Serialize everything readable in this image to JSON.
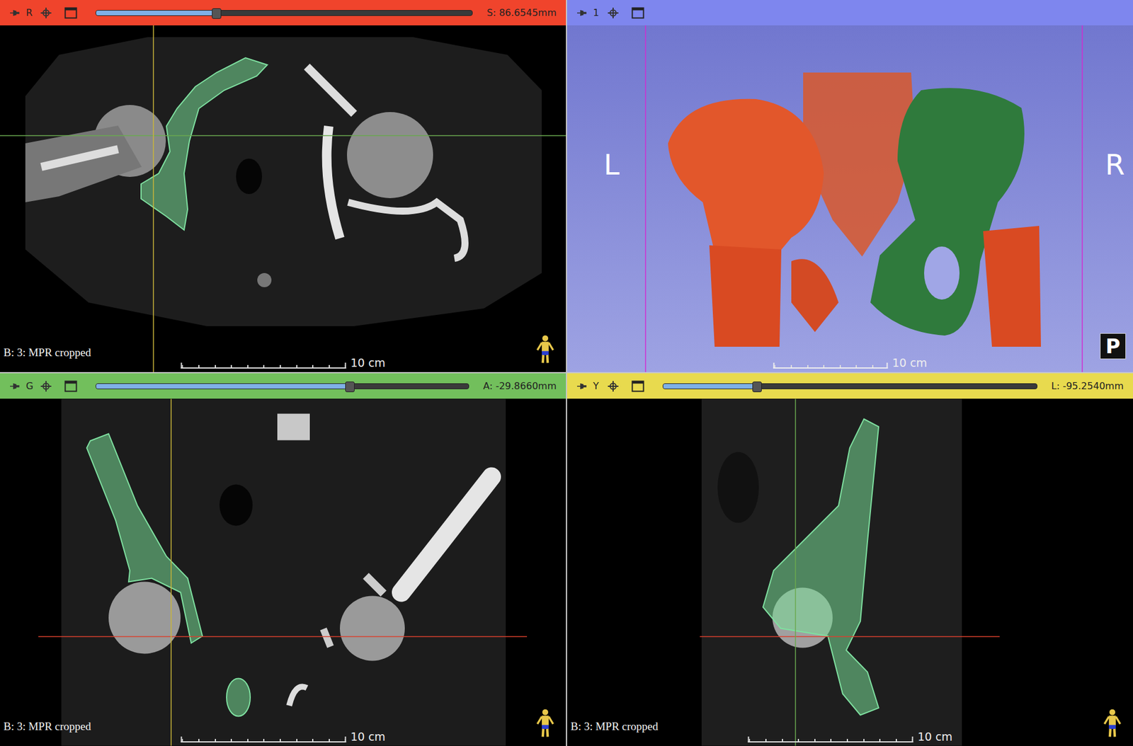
{
  "views": [
    {
      "kind": "axial",
      "letter": "R",
      "value": "S: 86.6545mm",
      "level": 0.32,
      "color": "#f0442c",
      "annotation": "B: 3: MPR cropped",
      "scale": "10 cm"
    },
    {
      "kind": "3d",
      "letter": "1",
      "color": "#7e86ee",
      "left_label": "L",
      "right_label": "R",
      "orientation": "P",
      "scale": "10 cm"
    },
    {
      "kind": "coronal",
      "letter": "G",
      "value": "A: -29.8660mm",
      "level": 0.68,
      "color": "#72bf5c",
      "annotation": "B: 3: MPR cropped",
      "scale": "10 cm"
    },
    {
      "kind": "sagittal",
      "letter": "Y",
      "value": "L: -95.2540mm",
      "level": 0.25,
      "color": "#e8da4e",
      "annotation": "B: 3: MPR cropped",
      "scale": "10 cm"
    }
  ]
}
